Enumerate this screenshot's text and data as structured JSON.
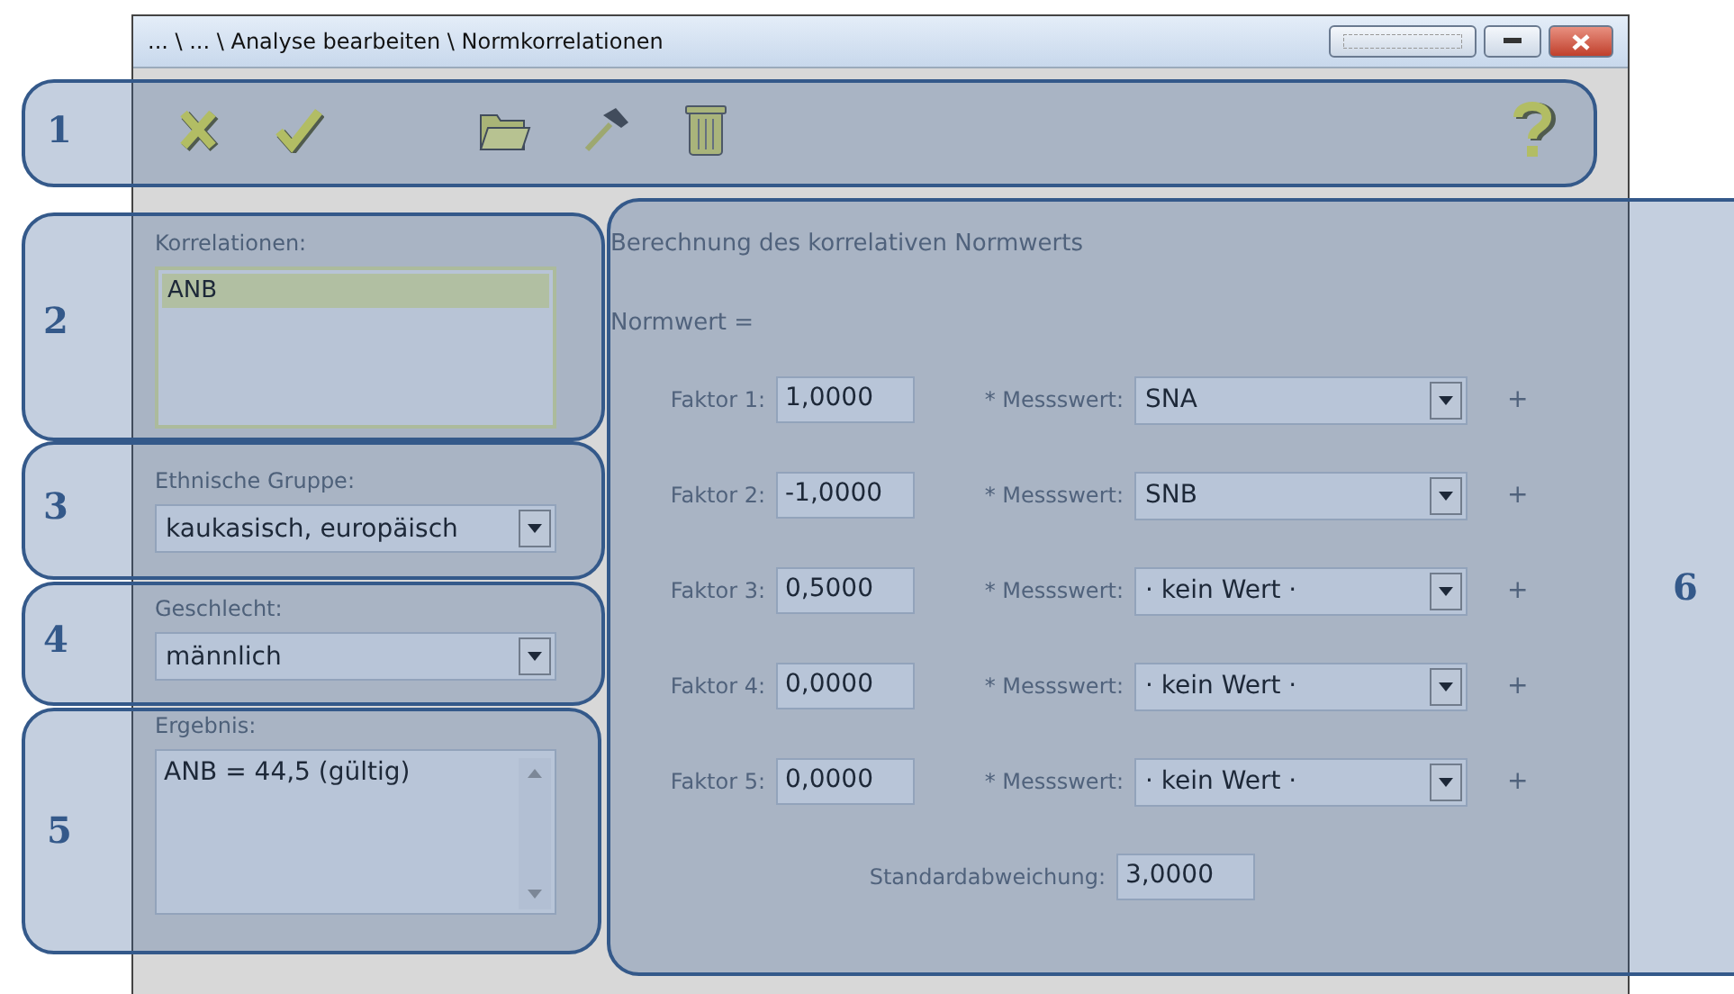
{
  "window": {
    "title": "... \\ ... \\ Analyse bearbeiten \\ Normkorrelationen"
  },
  "callouts": [
    {
      "number": "1"
    },
    {
      "number": "2"
    },
    {
      "number": "3"
    },
    {
      "number": "4"
    },
    {
      "number": "5"
    },
    {
      "number": "6"
    }
  ],
  "correlations": {
    "label": "Korrelationen:",
    "items": [
      {
        "text": "ANB",
        "selected": true
      }
    ]
  },
  "ethnic_group": {
    "label": "Ethnische Gruppe:",
    "value": "kaukasisch, europäisch"
  },
  "sex": {
    "label": "Geschlecht:",
    "value": "männlich"
  },
  "result": {
    "label": "Ergebnis:",
    "value": "ANB = 44,5 (gültig)"
  },
  "calculation": {
    "title": "Berechnung des korrelativen Normwerts",
    "formula_label": "Normwert =",
    "factors": [
      {
        "label": "Faktor 1:",
        "value": "1,0000",
        "measure_label": "* Messswert:",
        "measure": "SNA",
        "plus": "+"
      },
      {
        "label": "Faktor 2:",
        "value": "-1,0000",
        "measure_label": "* Messswert:",
        "measure": "SNB",
        "plus": "+"
      },
      {
        "label": "Faktor 3:",
        "value": "0,5000",
        "measure_label": "* Messswert:",
        "measure": "· kein Wert ·",
        "plus": "+"
      },
      {
        "label": "Faktor 4:",
        "value": "0,0000",
        "measure_label": "* Messswert:",
        "measure": "· kein Wert ·",
        "plus": "+"
      },
      {
        "label": "Faktor 5:",
        "value": "0,0000",
        "measure_label": "* Messswert:",
        "measure": "· kein Wert ·",
        "plus": "+"
      }
    ],
    "std_dev": {
      "label": "Standardabweichung:",
      "value": "3,0000"
    }
  }
}
